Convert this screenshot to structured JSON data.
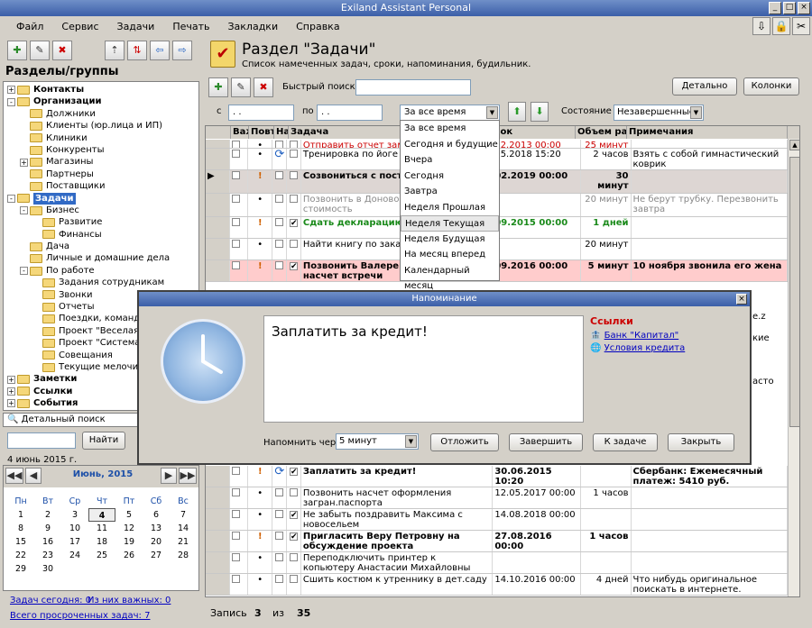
{
  "window": {
    "title": "Exiland Assistant Personal"
  },
  "menu": [
    "Файл",
    "Сервис",
    "Задачи",
    "Печать",
    "Закладки",
    "Справка"
  ],
  "left": {
    "heading": "Разделы/группы",
    "tree": [
      {
        "t": "Контакты",
        "lvl": 0,
        "pm": "+",
        "bold": true,
        "icon": "person"
      },
      {
        "t": "Организации",
        "lvl": 0,
        "pm": "-",
        "bold": true
      },
      {
        "t": "Должники",
        "lvl": 1
      },
      {
        "t": "Клиенты (юр.лица и ИП)",
        "lvl": 1
      },
      {
        "t": "Клиники",
        "lvl": 1
      },
      {
        "t": "Конкуренты",
        "lvl": 1
      },
      {
        "t": "Магазины",
        "lvl": 1,
        "pm": "+"
      },
      {
        "t": "Партнеры",
        "lvl": 1
      },
      {
        "t": "Поставщики",
        "lvl": 1
      },
      {
        "t": "Задачи",
        "lvl": 0,
        "pm": "-",
        "bold": true,
        "sel": true
      },
      {
        "t": "Бизнес",
        "lvl": 1,
        "pm": "-"
      },
      {
        "t": "Развитие",
        "lvl": 2
      },
      {
        "t": "Финансы",
        "lvl": 2
      },
      {
        "t": "Дача",
        "lvl": 1
      },
      {
        "t": "Личные и домашние дела",
        "lvl": 1
      },
      {
        "t": "По работе",
        "lvl": 1,
        "pm": "-"
      },
      {
        "t": "Задания сотрудникам",
        "lvl": 2
      },
      {
        "t": "Звонки",
        "lvl": 2
      },
      {
        "t": "Отчеты",
        "lvl": 2
      },
      {
        "t": "Поездки, команд",
        "lvl": 2
      },
      {
        "t": "Проект \"Веселая",
        "lvl": 2
      },
      {
        "t": "Проект \"Система",
        "lvl": 2
      },
      {
        "t": "Совещания",
        "lvl": 2
      },
      {
        "t": "Текущие мелочи",
        "lvl": 2
      },
      {
        "t": "Заметки",
        "lvl": 0,
        "pm": "+",
        "bold": true
      },
      {
        "t": "Ссылки",
        "lvl": 0,
        "pm": "+",
        "bold": true
      },
      {
        "t": "События",
        "lvl": 0,
        "pm": "+",
        "bold": true
      }
    ],
    "search_label": "Детальный поиск",
    "find_btn": "Найти",
    "date": "4 июнь 2015 г.",
    "cal_month": "Июнь, 2015",
    "weekdays": [
      "Пн",
      "Вт",
      "Ср",
      "Чт",
      "Пт",
      "Сб",
      "Вс"
    ],
    "weeks": [
      [
        "1",
        "2",
        "3",
        "4",
        "5",
        "6",
        "7"
      ],
      [
        "8",
        "9",
        "10",
        "11",
        "12",
        "13",
        "14"
      ],
      [
        "15",
        "16",
        "17",
        "18",
        "19",
        "20",
        "21"
      ],
      [
        "22",
        "23",
        "24",
        "25",
        "26",
        "27",
        "28"
      ],
      [
        "29",
        "30",
        "",
        "",
        "",
        "",
        ""
      ]
    ],
    "today_label": "Задач сегодня: 0",
    "important_label": "Из них важных: 0",
    "overdue_label": "Всего просроченных задач: 7"
  },
  "section": {
    "title": "Раздел \"Задачи\"",
    "subtitle": "Список намеченных задач, сроки, напоминания, будильник."
  },
  "toolbar": {
    "quick_search": "Быстрый поиск",
    "detail_btn": "Детально",
    "columns_btn": "Колонки"
  },
  "filter": {
    "from": "с",
    "to": "по",
    "date_placeholder": ". .",
    "period": "За все время",
    "state_label": "Состояние",
    "state": "Незавершенные"
  },
  "dropdown": [
    "За все время",
    "Сегодня и будущие",
    "Вчера",
    "Сегодня",
    "Завтра",
    "Неделя Прошлая",
    "Неделя Текущая",
    "Неделя Будущая",
    "На месяц вперед",
    "Календарный месяц"
  ],
  "grid": {
    "headers": [
      "Важ",
      "Повт",
      "На",
      "Задача",
      "Срок",
      "Объем раб",
      "Примечания"
    ],
    "rows": [
      {
        "task": "Отправить отчет зам. дир",
        "date": "12.2013 00:00",
        "vol": "25 минут",
        "note": "",
        "style": "red",
        "imp": false,
        "rep": false,
        "chk": false
      },
      {
        "task": "Тренировка по йоге",
        "date": "05.2018 15:20",
        "vol": "2 часов",
        "note": "Взять с собой гимнастический коврик",
        "style": "",
        "imp": false,
        "rep": true,
        "chk": false
      },
      {
        "task": "Созвониться с постав",
        "date": "02.2019 00:00",
        "vol": "30 минут",
        "note": "",
        "style": "boldsel",
        "imp": true,
        "rep": false,
        "chk": false
      },
      {
        "task": "Позвонить в Доновой на узнать стоимость",
        "date": "",
        "vol": "20 минут",
        "note": "Не берут трубку. Перезвонить завтра",
        "style": "gray",
        "imp": false,
        "rep": false,
        "chk": false
      },
      {
        "task": "Сдать декларацию в фонд",
        "date": "09.2015 00:00",
        "vol": "1 дней",
        "note": "",
        "style": "green",
        "imp": true,
        "rep": false,
        "chk": true
      },
      {
        "task": "Найти книгу по закалива Свете",
        "date": "",
        "vol": "20 минут",
        "note": "",
        "style": "",
        "imp": false,
        "rep": false,
        "chk": false
      },
      {
        "task": "Позвонить Валере и д вторник насчет встречи",
        "date": "09.2016 00:00",
        "vol": "5 минут",
        "note": "10 ноября звонила его жена",
        "style": "pink",
        "imp": true,
        "rep": false,
        "chk": true
      }
    ],
    "rows2": [
      {
        "task": "Заплатить за кредит!",
        "date": "30.06.2015 10:20",
        "vol": "",
        "note": "Сбербанк: Ежемесячный платеж: 5410 руб.",
        "style": "bold",
        "imp": true,
        "rep": true,
        "chk": true
      },
      {
        "task": "Позвонить насчет оформления загран.паспорта",
        "date": "12.05.2017 00:00",
        "vol": "1 часов",
        "note": "",
        "style": "",
        "imp": false,
        "rep": false,
        "chk": false
      },
      {
        "task": "Не забыть поздравить Максима с новосельем",
        "date": "14.08.2018 00:00",
        "vol": "",
        "note": "",
        "style": "",
        "imp": false,
        "rep": false,
        "chk": true
      },
      {
        "task": "Пригласить Веру Петровну на обсуждение проекта",
        "date": "27.08.2016 00:00",
        "vol": "1 часов",
        "note": "",
        "style": "bold",
        "imp": true,
        "rep": false,
        "chk": true
      },
      {
        "task": "Переподключить принтер к копьютеру Анастасии Михайловны",
        "date": "",
        "vol": "",
        "note": "",
        "style": "",
        "imp": false,
        "rep": false,
        "chk": false
      },
      {
        "task": "Сшить костюм к утреннику в дет.саду",
        "date": "14.10.2016 00:00",
        "vol": "4 дней",
        "note": "Что нибудь оригинальное поискать в интернете.",
        "style": "",
        "imp": false,
        "rep": false,
        "chk": false
      }
    ],
    "side_notes": [
      "e.z",
      "кие",
      "",
      "асто"
    ]
  },
  "dialog": {
    "title": "Напоминание",
    "message": "Заплатить за кредит!",
    "links_title": "Ссылки",
    "links": [
      "Банк \"Капитал\"",
      "Условия кредита"
    ],
    "remind_label": "Напомнить через",
    "remind_value": "5 минут",
    "buttons": [
      "Отложить",
      "Завершить",
      "К задаче",
      "Закрыть"
    ]
  },
  "status": {
    "record_label": "Запись",
    "record": "3",
    "of_label": "из",
    "total": "35"
  }
}
